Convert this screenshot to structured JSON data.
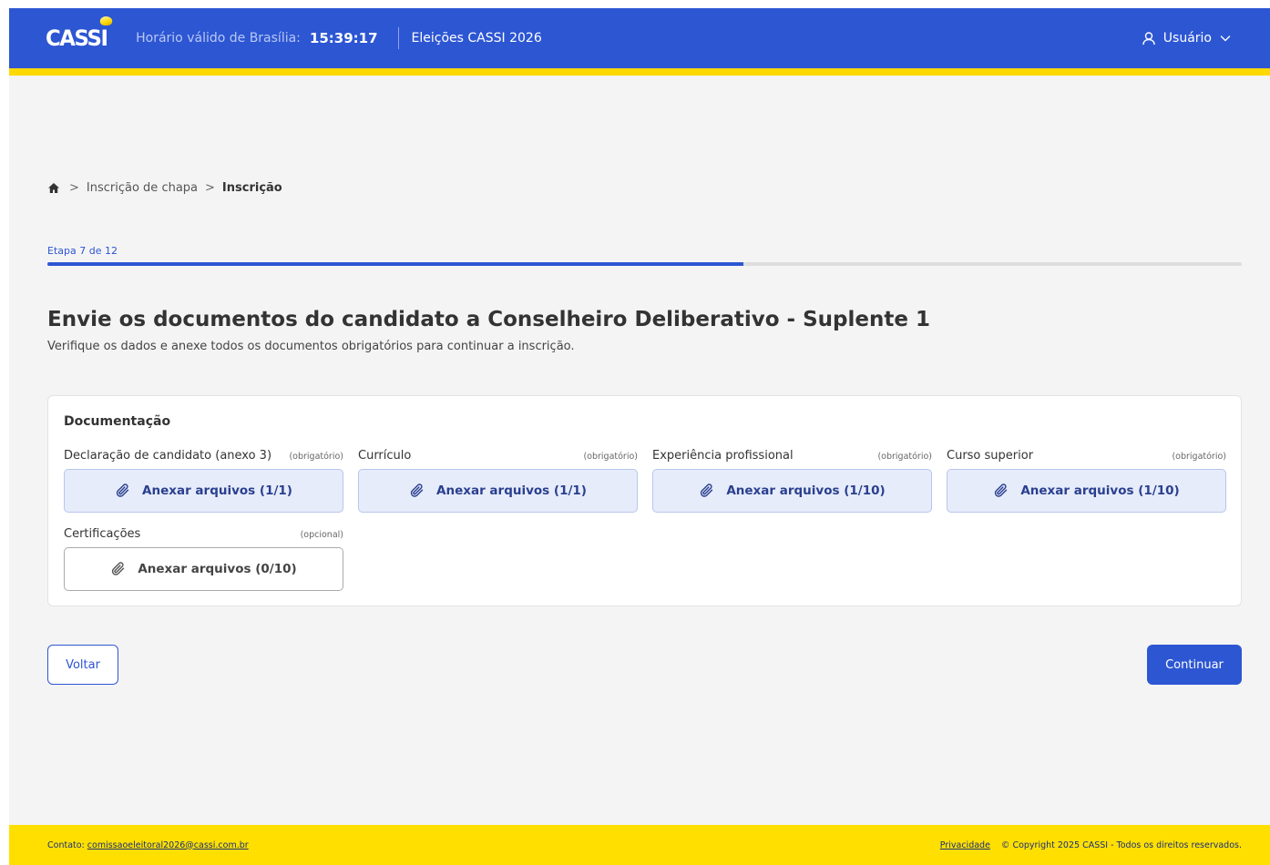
{
  "header": {
    "logo_text": "CASSI",
    "time_label": "Horário válido de Brasília:",
    "time_value": "15:39:17",
    "title": "Eleições CASSI 2026",
    "user_label": "Usuário"
  },
  "breadcrumb": {
    "items": [
      "Inscrição de chapa"
    ],
    "current": "Inscrição",
    "separator": ">"
  },
  "progress": {
    "label": "Etapa 7 de 12",
    "fraction": 0.583
  },
  "page": {
    "title": "Envie os documentos do candidato a Conselheiro Deliberativo - Suplente 1",
    "subtitle": "Verifique os dados e anexe todos os documentos obrigatórios para continuar a inscrição."
  },
  "documents": {
    "section_title": "Documentação",
    "items": [
      {
        "name": "Declaração de candidato (anexo 3)",
        "requirement": "(obrigatório)",
        "button": "Anexar arquivos (1/1)",
        "attached": true
      },
      {
        "name": "Currículo",
        "requirement": "(obrigatório)",
        "button": "Anexar arquivos (1/1)",
        "attached": true
      },
      {
        "name": "Experiência profissional",
        "requirement": "(obrigatório)",
        "button": "Anexar arquivos (1/10)",
        "attached": true
      },
      {
        "name": "Curso superior",
        "requirement": "(obrigatório)",
        "button": "Anexar arquivos (1/10)",
        "attached": true
      },
      {
        "name": "Certificações",
        "requirement": "(opcional)",
        "button": "Anexar arquivos (0/10)",
        "attached": false
      }
    ]
  },
  "actions": {
    "back_label": "Voltar",
    "next_label": "Continuar"
  },
  "footer": {
    "contact_label": "Contato:",
    "contact_email": "comissaoeleitoral2026@cassi.com.br",
    "privacy_label": "Privacidade",
    "copyright": "© Copyright 2025 CASSI - Todos os direitos reservados."
  },
  "colors": {
    "brand_blue": "#2d56d3",
    "brand_yellow": "#ffd800",
    "background": "#f4f4f4"
  },
  "icons": {
    "home": "home-icon",
    "user": "user-icon",
    "chevron": "chevron-down-icon",
    "attach": "paperclip-icon"
  }
}
